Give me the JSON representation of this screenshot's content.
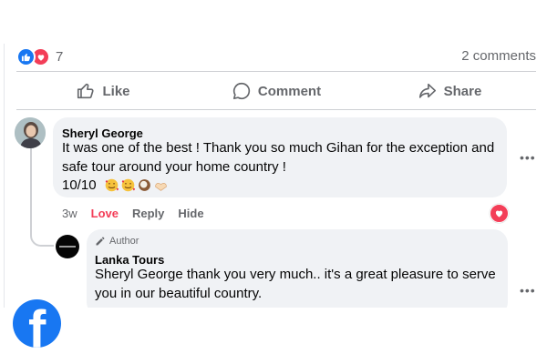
{
  "reactions": {
    "count": "7"
  },
  "comments_count": "2 comments",
  "actions": {
    "like": "Like",
    "comment": "Comment",
    "share": "Share"
  },
  "comment1": {
    "author": "Sheryl George",
    "text_line1": "It was one of the best ! Thank you so much Gihan for the exception and",
    "text_line2": "safe tour around your home country !",
    "text_line3": "10/10",
    "emojis": [
      "smiling-face-with-hearts",
      "smiling-face-with-hearts",
      "coconut",
      "heart-hands"
    ],
    "time": "3w",
    "love_label": "Love",
    "reply_label": "Reply",
    "hide_label": "Hide"
  },
  "reply": {
    "badge": "Author",
    "author": "Lanka Tours",
    "text_line1": "Sheryl George thank you very much.. it's a great pleasure to serve",
    "text_line2": "you in our beautiful country."
  },
  "colors": {
    "facebook_blue": "#1877f2",
    "love_red": "#f33e58",
    "secondary_text": "#65676b"
  },
  "icons": [
    "like-reaction-icon",
    "love-reaction-icon",
    "thumbs-up-icon",
    "comment-icon",
    "share-icon",
    "more-options-icon",
    "pencil-icon",
    "facebook-logo-icon"
  ]
}
